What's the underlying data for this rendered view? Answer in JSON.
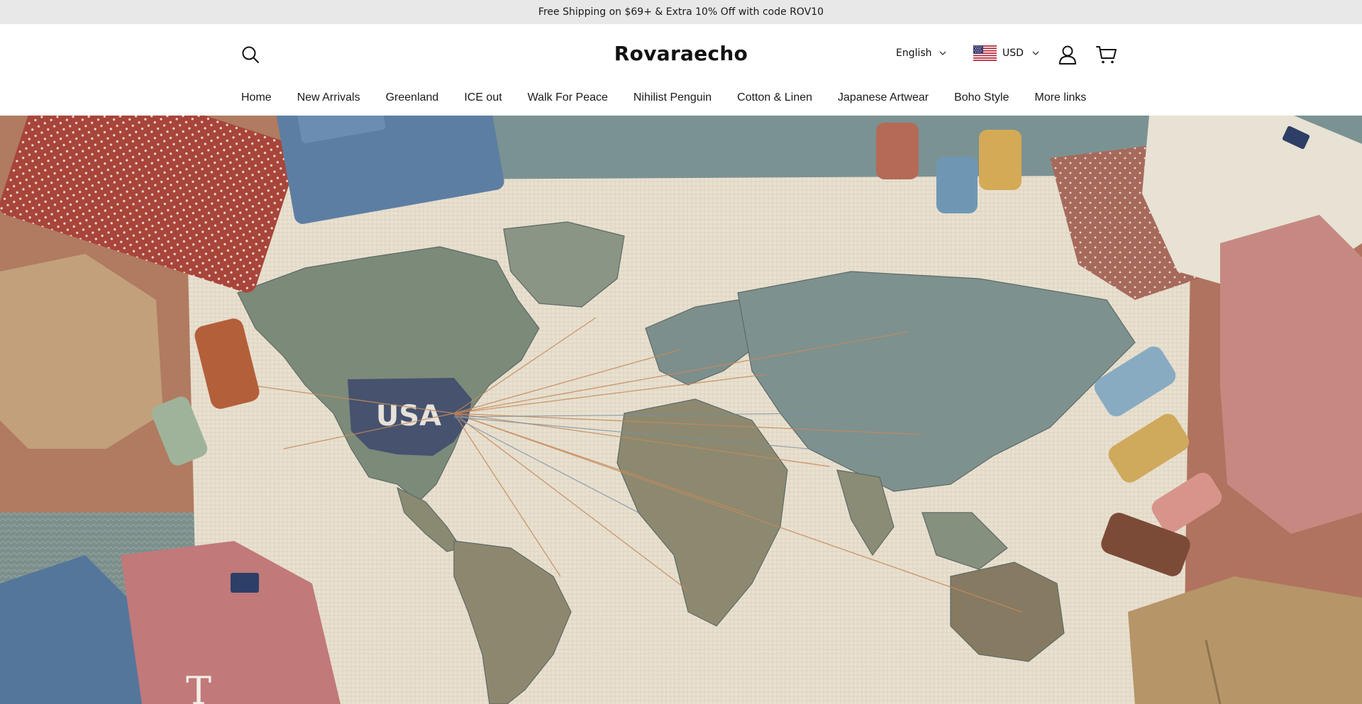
{
  "announcement": {
    "text": "Free Shipping on $69+ & Extra 10% Off with code ROV10"
  },
  "header": {
    "logo": "Rovaraecho",
    "language": "English",
    "currency": "USD"
  },
  "nav": {
    "items": [
      {
        "label": "Home"
      },
      {
        "label": "New Arrivals"
      },
      {
        "label": "Greenland"
      },
      {
        "label": "ICE out"
      },
      {
        "label": "Walk For Peace"
      },
      {
        "label": "Nihilist Penguin"
      },
      {
        "label": "Cotton & Linen"
      },
      {
        "label": "Japanese Artwear"
      },
      {
        "label": "Boho Style"
      },
      {
        "label": "More links"
      }
    ]
  },
  "hero": {
    "map_label": "USA"
  },
  "icons": [
    "search-icon",
    "chevron-down-icon",
    "us-flag-icon",
    "user-icon",
    "cart-icon"
  ],
  "colors": {
    "announcement_bg": "#e8e8e8",
    "map_usa": "#46526e",
    "thread": "#c48a5c"
  }
}
